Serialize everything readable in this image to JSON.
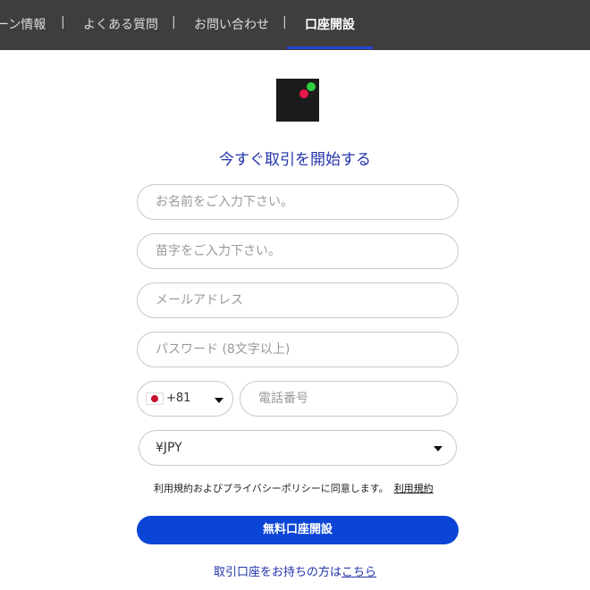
{
  "nav": {
    "items": [
      "ーン情報",
      "よくある質問",
      "お問い合わせ",
      "口座開設"
    ],
    "separator": "|"
  },
  "colors": {
    "nav_bg": "#3e3e3e",
    "accent": "#0b45d6",
    "title": "#2233aa",
    "logo_green": "#2ed13f",
    "logo_red": "#e8194a"
  },
  "form": {
    "title": "今すぐ取引を開始する",
    "first_name_placeholder": "お名前をご入力下さい。",
    "last_name_placeholder": "苗字をご入力下さい。",
    "email_placeholder": "メールアドレス",
    "password_placeholder": "パスワード (8文字以上)",
    "phone_code": "+81",
    "phone_placeholder": "電話番号",
    "currency": "¥JPY",
    "terms_text": "利用規約およびプライバシーポリシーに同意します。",
    "terms_link": "利用規約",
    "submit_label": "無料口座開設",
    "login_text": "取引口座をお持ちの方は",
    "login_link": "こちら"
  },
  "icons": {
    "flag": "japan-flag-icon",
    "caret": "caret-down-icon"
  }
}
